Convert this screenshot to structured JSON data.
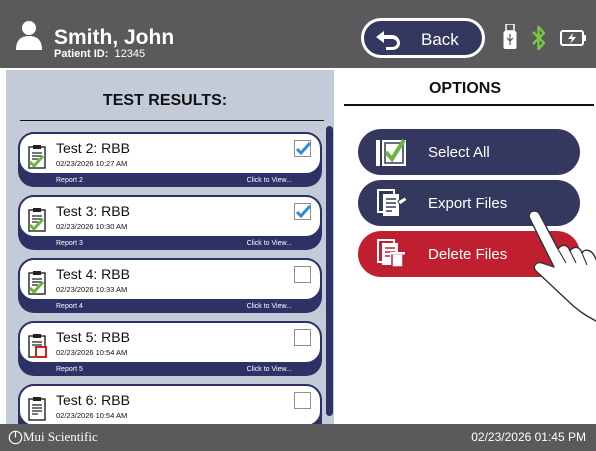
{
  "header": {
    "patient_name": "Smith, John",
    "patient_id_label": "Patient ID:",
    "patient_id": "12345",
    "back_label": "Back",
    "icons": [
      "user-icon",
      "back-arrow-icon",
      "usb-icon",
      "bluetooth-icon",
      "battery-charging-icon"
    ]
  },
  "results": {
    "title": "TEST RESULTS:",
    "footer_action": "Click to View...",
    "items": [
      {
        "title": "Test 2: RBB",
        "date": "02/23/2026 10:27 AM",
        "report": "Report 2",
        "checked": true,
        "status": "check"
      },
      {
        "title": "Test 3: RBB",
        "date": "02/23/2026 10:30 AM",
        "report": "Report 3",
        "checked": true,
        "status": "check"
      },
      {
        "title": "Test 4: RBB",
        "date": "02/23/2026 10:33 AM",
        "report": "Report 4",
        "checked": false,
        "status": "check"
      },
      {
        "title": "Test 5: RBB",
        "date": "02/23/2026 10:54 AM",
        "report": "Report 5",
        "checked": false,
        "status": "red-box"
      },
      {
        "title": "Test 6: RBB",
        "date": "02/23/2026 10:54 AM",
        "report": "",
        "checked": false,
        "status": "none"
      }
    ]
  },
  "options": {
    "title": "OPTIONS",
    "select_all": "Select All",
    "export_files": "Export Files",
    "delete_files": "Delete Files"
  },
  "footer": {
    "brand": "Mui Scientific",
    "datetime": "02/23/2026 01:45 PM"
  },
  "colors": {
    "header_bg": "#5a5a5c",
    "navy": "#34375e",
    "card_navy": "#2d3166",
    "delete_red": "#c01f2f",
    "panel_blue_gray": "#c3cbd9",
    "check_blue": "#2e8bd6",
    "check_green": "#6db33f",
    "bluetooth_green": "#7ac943"
  }
}
